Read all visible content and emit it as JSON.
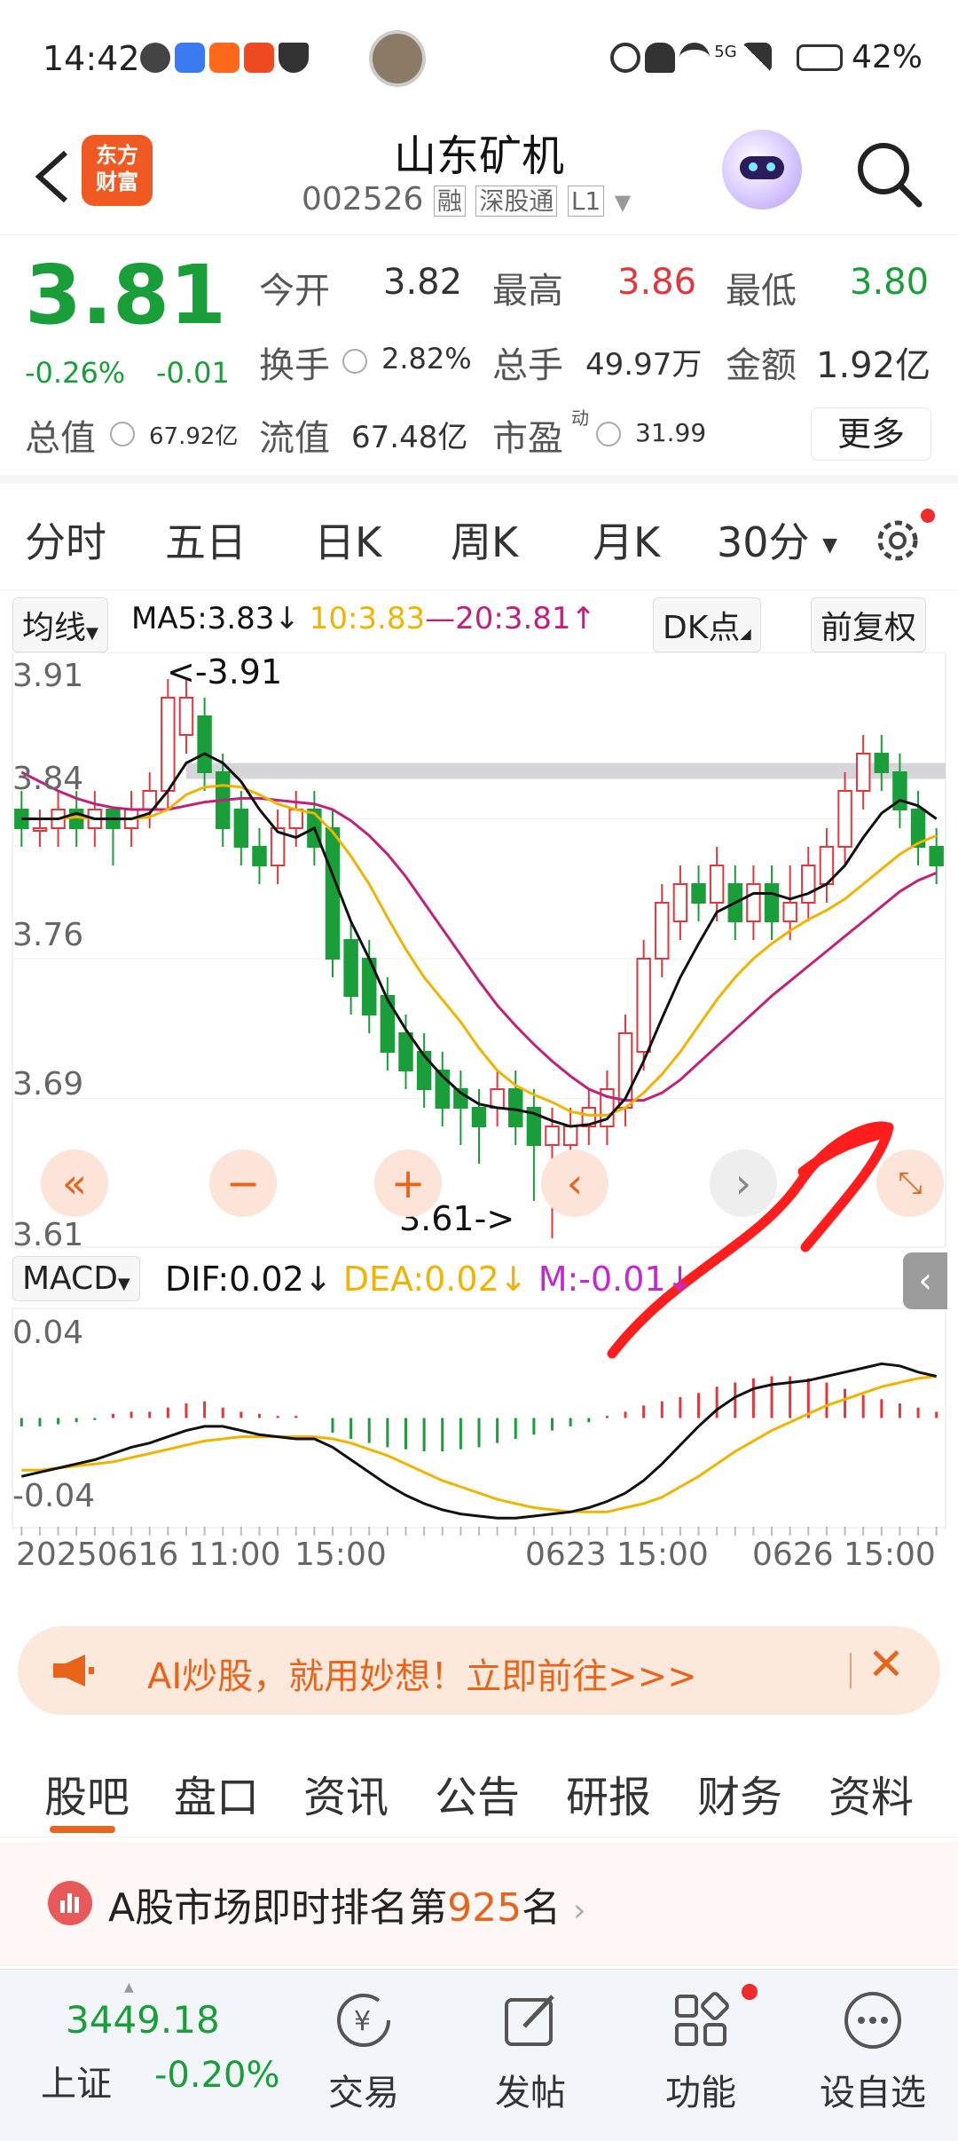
{
  "status": {
    "time": "14:42",
    "battery": "42%",
    "network": "5G",
    "icons": [
      "wechat-icon",
      "message-icon",
      "app-icon",
      "listen-icon",
      "shield-icon",
      "alarm-icon",
      "mute-icon",
      "wifi-icon",
      "signal-icon",
      "battery-icon"
    ]
  },
  "header": {
    "back_icon": "back-chevron-icon",
    "logo_text": "东方财富",
    "stock_name": "山东矿机",
    "stock_code": "002526",
    "tags": [
      "融",
      "深股通",
      "L1"
    ],
    "robot_icon": "ai-robot-icon",
    "search_icon": "search-icon"
  },
  "quote": {
    "price": "3.81",
    "change_pct": "-0.26%",
    "change_amt": "-0.01",
    "fields": [
      {
        "label": "今开",
        "value": "3.82"
      },
      {
        "label": "最高",
        "value": "3.86"
      },
      {
        "label": "最低",
        "value": "3.80"
      },
      {
        "label": "换手",
        "value": "2.82%"
      },
      {
        "label": "总手",
        "value": "49.97万"
      },
      {
        "label": "金额",
        "value": "1.92亿"
      },
      {
        "label": "总值",
        "value": "67.92亿"
      },
      {
        "label": "流值",
        "value": "67.48亿"
      },
      {
        "label": "市盈",
        "value": "31.99",
        "superscript": "动"
      }
    ],
    "more_label": "更多"
  },
  "period_tabs": {
    "items": [
      "分时",
      "五日",
      "日K",
      "周K",
      "月K",
      "30分"
    ],
    "active_index": 5,
    "settings_icon": "gear-icon"
  },
  "chart_bar": {
    "ma_select": "均线",
    "ma5": "MA5:3.83",
    "ma10": "10:3.83",
    "ma20": "20:3.81",
    "dk": "DK点",
    "adjust": "前复权"
  },
  "colors": {
    "up": "#e0383e",
    "down": "#1a9e3a",
    "accent": "#e8641b",
    "ma5": "#111111",
    "ma10": "#f0b400",
    "ma20": "#c0227a",
    "dea": "#f0b400",
    "m": "#c22ad1"
  },
  "chart_data": [
    {
      "type": "candlestick",
      "y_ticks": [
        "3.91",
        "3.84",
        "3.76",
        "3.69",
        "3.61"
      ],
      "ylim": [
        3.61,
        3.91
      ],
      "annotations": [
        "<-3.91",
        "3.61->"
      ],
      "x_labels": [
        "20250616 11:00",
        "15:00",
        "0623 15:00",
        "0626 15:00"
      ],
      "candles": [
        [
          3.84,
          3.83,
          3.85,
          3.82
        ],
        [
          3.83,
          3.83,
          3.84,
          3.82
        ],
        [
          3.83,
          3.84,
          3.85,
          3.82
        ],
        [
          3.84,
          3.83,
          3.85,
          3.82
        ],
        [
          3.83,
          3.84,
          3.85,
          3.82
        ],
        [
          3.84,
          3.83,
          3.84,
          3.81
        ],
        [
          3.83,
          3.84,
          3.85,
          3.82
        ],
        [
          3.84,
          3.85,
          3.86,
          3.83
        ],
        [
          3.85,
          3.9,
          3.91,
          3.84
        ],
        [
          3.88,
          3.9,
          3.91,
          3.87
        ],
        [
          3.89,
          3.86,
          3.9,
          3.85
        ],
        [
          3.86,
          3.83,
          3.87,
          3.82
        ],
        [
          3.84,
          3.82,
          3.85,
          3.81
        ],
        [
          3.82,
          3.81,
          3.83,
          3.8
        ],
        [
          3.81,
          3.83,
          3.84,
          3.8
        ],
        [
          3.83,
          3.84,
          3.85,
          3.82
        ],
        [
          3.84,
          3.82,
          3.85,
          3.81
        ],
        [
          3.83,
          3.76,
          3.84,
          3.75
        ],
        [
          3.77,
          3.74,
          3.78,
          3.73
        ],
        [
          3.76,
          3.73,
          3.77,
          3.72
        ],
        [
          3.74,
          3.71,
          3.75,
          3.7
        ],
        [
          3.72,
          3.7,
          3.73,
          3.69
        ],
        [
          3.71,
          3.69,
          3.72,
          3.68
        ],
        [
          3.7,
          3.68,
          3.71,
          3.67
        ],
        [
          3.69,
          3.68,
          3.7,
          3.66
        ],
        [
          3.68,
          3.67,
          3.69,
          3.65
        ],
        [
          3.68,
          3.69,
          3.7,
          3.67
        ],
        [
          3.69,
          3.67,
          3.7,
          3.66
        ],
        [
          3.68,
          3.66,
          3.69,
          3.63
        ],
        [
          3.66,
          3.67,
          3.68,
          3.61
        ],
        [
          3.66,
          3.67,
          3.68,
          3.65
        ],
        [
          3.67,
          3.68,
          3.69,
          3.66
        ],
        [
          3.67,
          3.69,
          3.7,
          3.66
        ],
        [
          3.68,
          3.72,
          3.73,
          3.67
        ],
        [
          3.71,
          3.76,
          3.77,
          3.7
        ],
        [
          3.76,
          3.79,
          3.8,
          3.75
        ],
        [
          3.78,
          3.8,
          3.81,
          3.77
        ],
        [
          3.8,
          3.79,
          3.81,
          3.78
        ],
        [
          3.79,
          3.81,
          3.82,
          3.78
        ],
        [
          3.8,
          3.78,
          3.81,
          3.77
        ],
        [
          3.78,
          3.8,
          3.81,
          3.77
        ],
        [
          3.8,
          3.78,
          3.81,
          3.77
        ],
        [
          3.78,
          3.79,
          3.81,
          3.77
        ],
        [
          3.79,
          3.81,
          3.82,
          3.78
        ],
        [
          3.8,
          3.82,
          3.83,
          3.79
        ],
        [
          3.82,
          3.85,
          3.86,
          3.81
        ],
        [
          3.85,
          3.87,
          3.88,
          3.84
        ],
        [
          3.87,
          3.86,
          3.88,
          3.85
        ],
        [
          3.86,
          3.84,
          3.87,
          3.83
        ],
        [
          3.84,
          3.82,
          3.85,
          3.81
        ],
        [
          3.82,
          3.81,
          3.83,
          3.8
        ]
      ],
      "ma5": [
        3.835,
        3.835,
        3.835,
        3.838,
        3.835,
        3.835,
        3.835,
        3.838,
        3.85,
        3.865,
        3.87,
        3.865,
        3.855,
        3.84,
        3.828,
        3.825,
        3.83,
        3.805,
        3.78,
        3.76,
        3.738,
        3.722,
        3.708,
        3.697,
        3.688,
        3.682,
        3.68,
        3.679,
        3.677,
        3.673,
        3.67,
        3.671,
        3.674,
        3.685,
        3.705,
        3.728,
        3.75,
        3.768,
        3.785,
        3.79,
        3.795,
        3.795,
        3.792,
        3.795,
        3.8,
        3.81,
        3.825,
        3.838,
        3.845,
        3.842,
        3.835
      ],
      "ma10": [
        3.835,
        3.835,
        3.835,
        3.836,
        3.835,
        3.835,
        3.835,
        3.836,
        3.84,
        3.848,
        3.852,
        3.853,
        3.852,
        3.848,
        3.843,
        3.84,
        3.838,
        3.828,
        3.815,
        3.8,
        3.782,
        3.765,
        3.75,
        3.738,
        3.726,
        3.712,
        3.7,
        3.692,
        3.687,
        3.683,
        3.678,
        3.676,
        3.676,
        3.68,
        3.688,
        3.698,
        3.71,
        3.724,
        3.738,
        3.75,
        3.76,
        3.768,
        3.775,
        3.781,
        3.786,
        3.792,
        3.8,
        3.808,
        3.816,
        3.822,
        3.826
      ],
      "ma20": [
        3.86,
        3.855,
        3.85,
        3.846,
        3.843,
        3.841,
        3.84,
        3.84,
        3.84,
        3.842,
        3.844,
        3.845,
        3.846,
        3.846,
        3.845,
        3.844,
        3.843,
        3.84,
        3.834,
        3.826,
        3.816,
        3.804,
        3.79,
        3.776,
        3.762,
        3.748,
        3.735,
        3.724,
        3.714,
        3.705,
        3.697,
        3.69,
        3.686,
        3.684,
        3.684,
        3.688,
        3.695,
        3.704,
        3.713,
        3.722,
        3.731,
        3.74,
        3.748,
        3.756,
        3.764,
        3.772,
        3.78,
        3.788,
        3.796,
        3.802,
        3.806
      ]
    },
    {
      "type": "macd",
      "title": "MACD",
      "labels": {
        "dif": "DIF:0.02",
        "dea": "DEA:0.02",
        "m": "M:-0.01"
      },
      "y_ticks": [
        "0.04",
        "-0.04"
      ],
      "ylim": [
        -0.05,
        0.05
      ],
      "histogram": [
        -0.004,
        -0.004,
        -0.003,
        -0.002,
        -0.001,
        0.002,
        0.003,
        0.003,
        0.005,
        0.007,
        0.008,
        0.005,
        0.003,
        0.002,
        0.001,
        0.001,
        0,
        -0.007,
        -0.01,
        -0.012,
        -0.014,
        -0.015,
        -0.016,
        -0.016,
        -0.015,
        -0.014,
        -0.012,
        -0.01,
        -0.008,
        -0.006,
        -0.004,
        -0.002,
        0.001,
        0.003,
        0.006,
        0.008,
        0.01,
        0.012,
        0.015,
        0.017,
        0.019,
        0.02,
        0.02,
        0.019,
        0.017,
        0.014,
        0.011,
        0.009,
        0.007,
        0.005,
        0.003
      ],
      "dif": [
        -0.028,
        -0.026,
        -0.024,
        -0.022,
        -0.02,
        -0.017,
        -0.014,
        -0.012,
        -0.009,
        -0.006,
        -0.004,
        -0.004,
        -0.006,
        -0.008,
        -0.009,
        -0.01,
        -0.01,
        -0.014,
        -0.02,
        -0.026,
        -0.032,
        -0.037,
        -0.041,
        -0.044,
        -0.046,
        -0.047,
        -0.048,
        -0.048,
        -0.047,
        -0.046,
        -0.045,
        -0.043,
        -0.04,
        -0.036,
        -0.03,
        -0.022,
        -0.013,
        -0.004,
        0.004,
        0.01,
        0.014,
        0.016,
        0.017,
        0.018,
        0.02,
        0.022,
        0.024,
        0.026,
        0.025,
        0.022,
        0.02
      ],
      "dea": [
        -0.025,
        -0.025,
        -0.024,
        -0.023,
        -0.022,
        -0.021,
        -0.019,
        -0.017,
        -0.015,
        -0.013,
        -0.011,
        -0.01,
        -0.009,
        -0.009,
        -0.009,
        -0.009,
        -0.009,
        -0.01,
        -0.012,
        -0.015,
        -0.018,
        -0.022,
        -0.026,
        -0.03,
        -0.033,
        -0.036,
        -0.039,
        -0.041,
        -0.043,
        -0.044,
        -0.045,
        -0.045,
        -0.045,
        -0.043,
        -0.041,
        -0.038,
        -0.033,
        -0.028,
        -0.022,
        -0.016,
        -0.011,
        -0.006,
        -0.002,
        0.002,
        0.006,
        0.009,
        0.012,
        0.015,
        0.017,
        0.019,
        0.02
      ]
    }
  ],
  "chart_controls": [
    "rewind-icon",
    "zoom-out-icon",
    "zoom-in-icon",
    "prev-icon",
    "next-icon",
    "fullscreen-icon"
  ],
  "banner": {
    "text": "AI炒股，就用妙想！立即前往>>>"
  },
  "info_tabs": {
    "items": [
      "股吧",
      "盘口",
      "资讯",
      "公告",
      "研报",
      "财务",
      "资料"
    ],
    "active_index": 0
  },
  "rank": {
    "prefix": "A股市场即时排名第",
    "number": "925",
    "suffix": "名"
  },
  "bottom_nav": {
    "index_value": "3449.18",
    "index_name": "上证",
    "index_change": "-0.20%",
    "items": [
      "交易",
      "发帖",
      "功能",
      "设自选"
    ]
  }
}
